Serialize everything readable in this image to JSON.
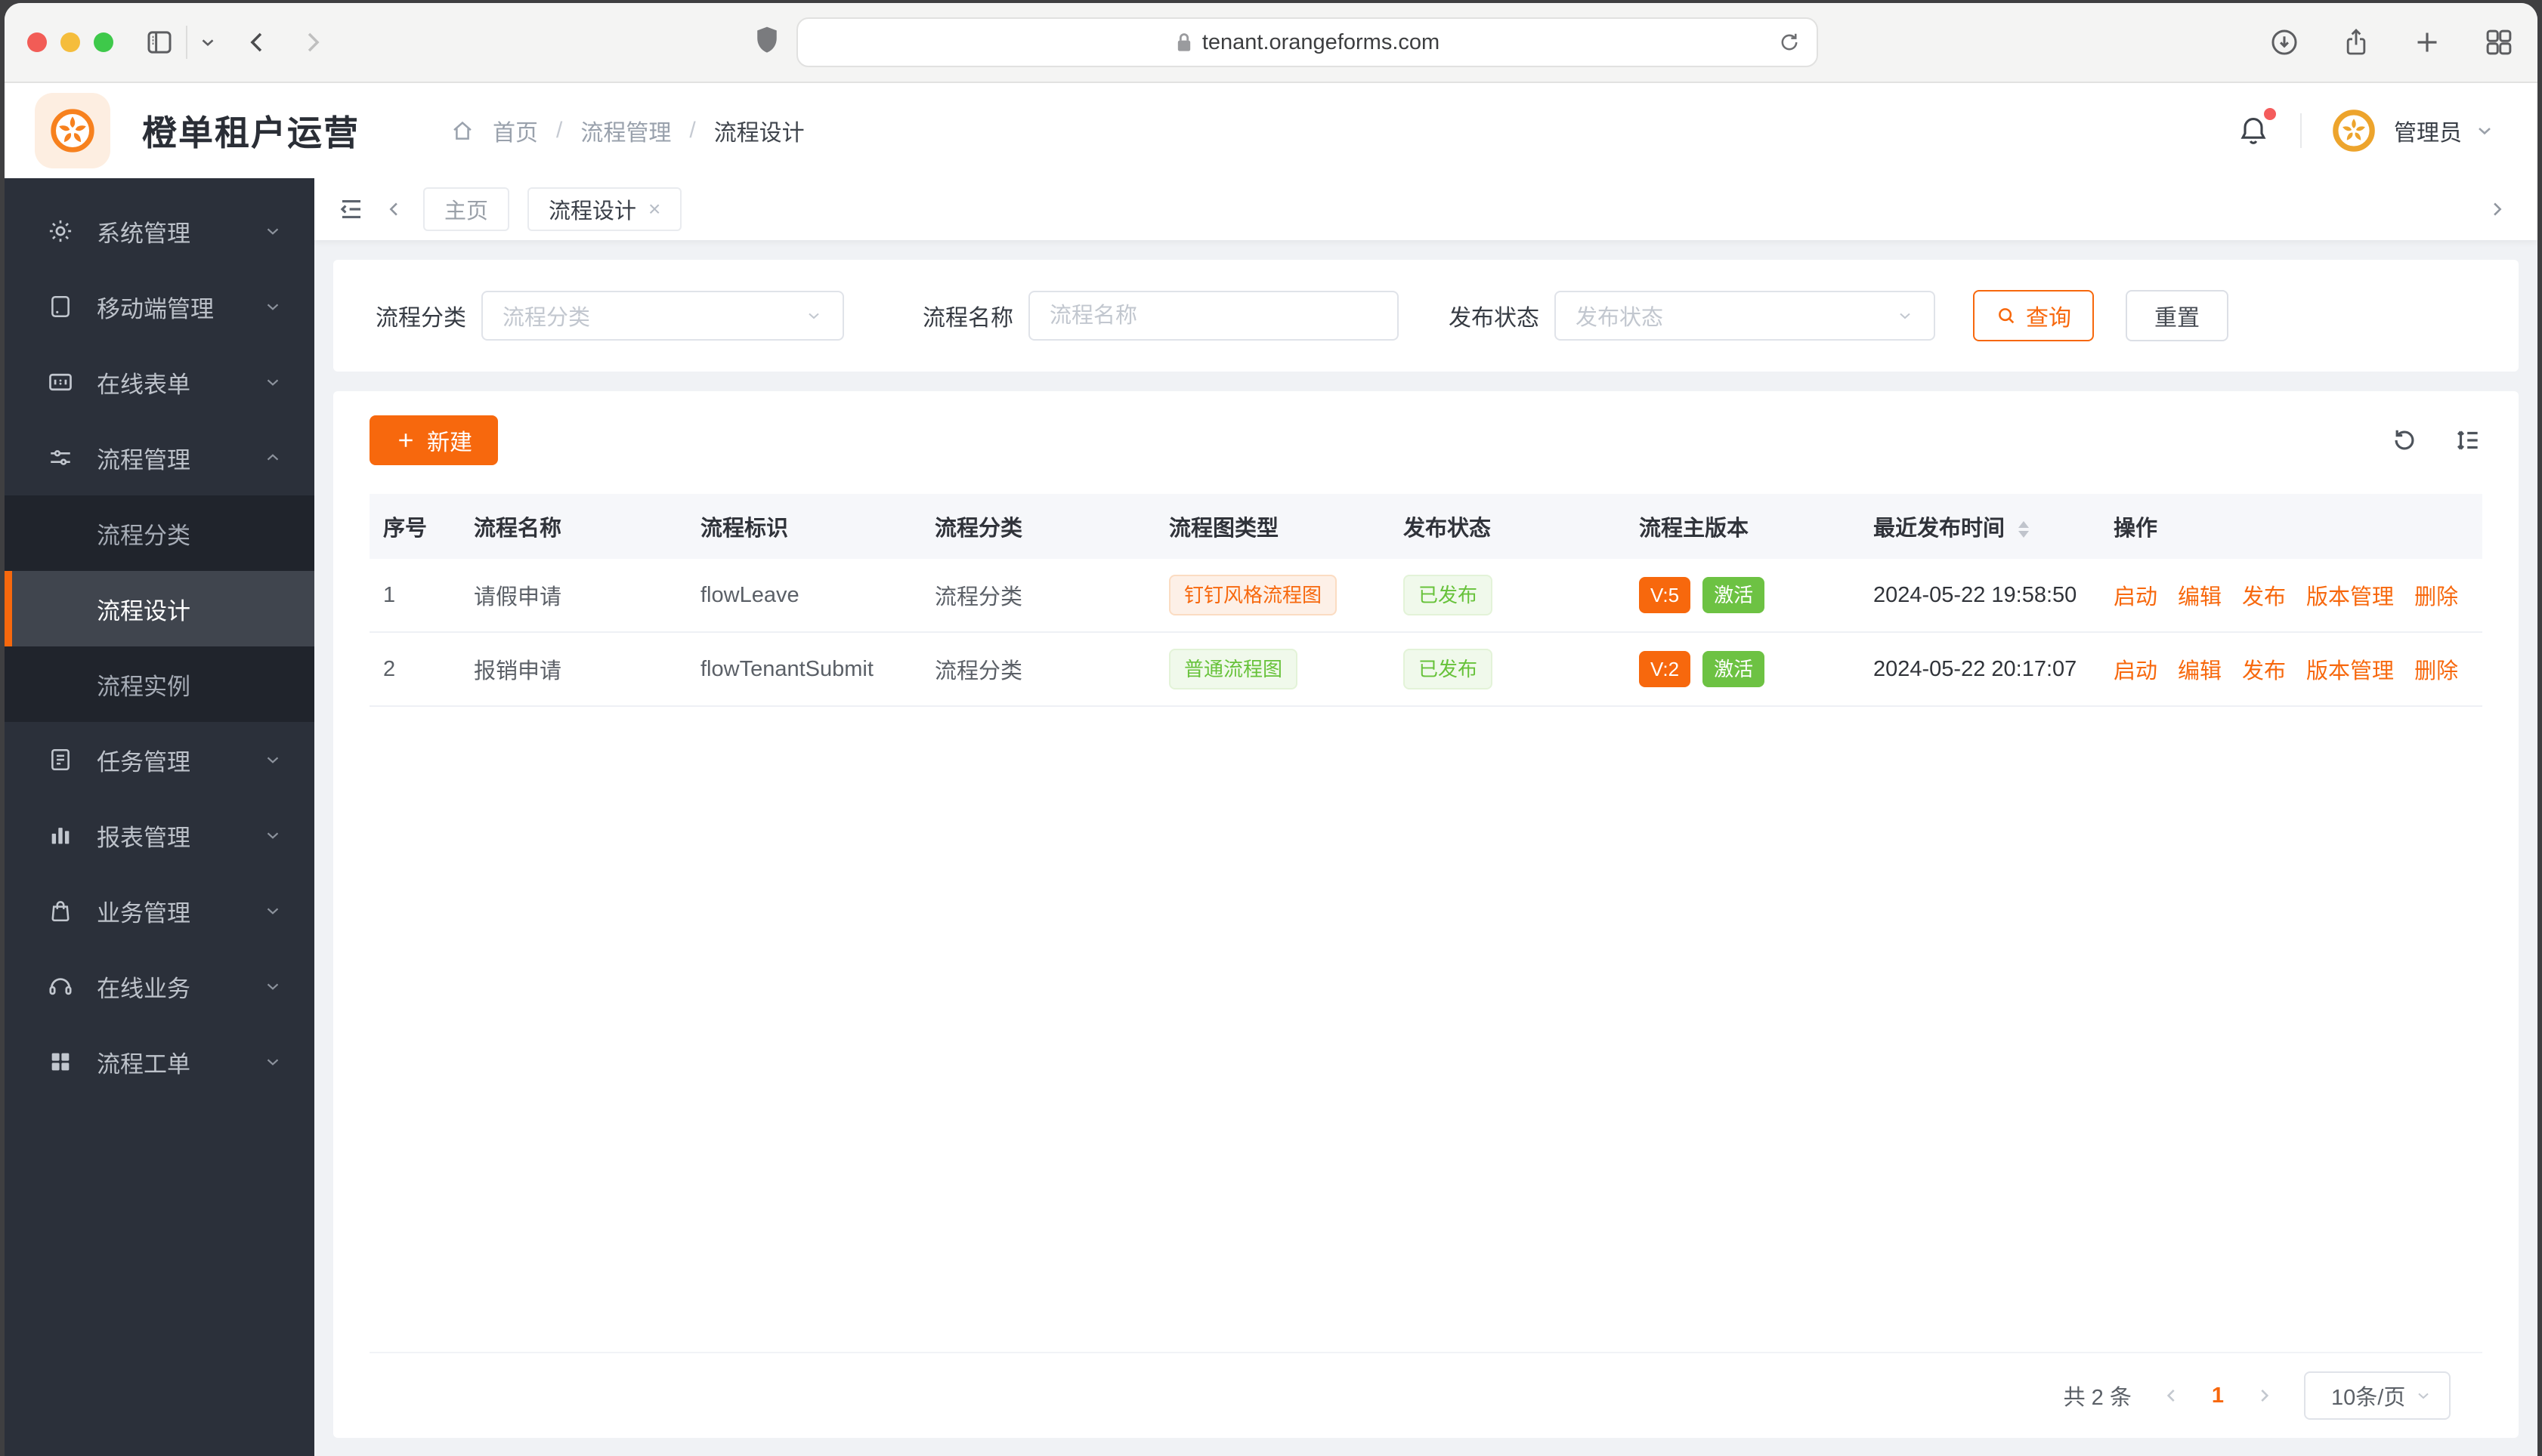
{
  "colors": {
    "accent": "#f7680d",
    "green": "#67c23a",
    "green_solid": "#6dc243",
    "sidebar_bg": "#2b303a"
  },
  "browser": {
    "url": "tenant.orangeforms.com"
  },
  "header": {
    "app_title": "橙单租户运营",
    "breadcrumb": [
      "首页",
      "流程管理",
      "流程设计"
    ],
    "user_name": "管理员"
  },
  "sidebar": {
    "items": [
      {
        "label": "系统管理"
      },
      {
        "label": "移动端管理"
      },
      {
        "label": "在线表单"
      },
      {
        "label": "流程管理",
        "expanded": true,
        "children": [
          {
            "label": "流程分类"
          },
          {
            "label": "流程设计",
            "active": true
          },
          {
            "label": "流程实例"
          }
        ]
      },
      {
        "label": "任务管理"
      },
      {
        "label": "报表管理"
      },
      {
        "label": "业务管理"
      },
      {
        "label": "在线业务"
      },
      {
        "label": "流程工单"
      }
    ]
  },
  "tabs": {
    "home": "主页",
    "current": "流程设计"
  },
  "filters": {
    "category_label": "流程分类",
    "category_placeholder": "流程分类",
    "name_label": "流程名称",
    "name_placeholder": "流程名称",
    "status_label": "发布状态",
    "status_placeholder": "发布状态",
    "query_label": "查询",
    "reset_label": "重置"
  },
  "toolbar": {
    "new_label": "新建"
  },
  "table": {
    "columns": [
      "序号",
      "流程名称",
      "流程标识",
      "流程分类",
      "流程图类型",
      "发布状态",
      "流程主版本",
      "最近发布时间",
      "操作"
    ],
    "row_actions": [
      "启动",
      "编辑",
      "发布",
      "版本管理",
      "删除"
    ],
    "rows": [
      {
        "index": "1",
        "name": "请假申请",
        "key": "flowLeave",
        "category": "流程分类",
        "diagram_type": "钉钉风格流程图",
        "diagram_style": "orange",
        "publish_status": "已发布",
        "version": "V:5",
        "version_state": "激活",
        "published_at": "2024-05-22 19:58:50"
      },
      {
        "index": "2",
        "name": "报销申请",
        "key": "flowTenantSubmit",
        "category": "流程分类",
        "diagram_type": "普通流程图",
        "diagram_style": "green",
        "publish_status": "已发布",
        "version": "V:2",
        "version_state": "激活",
        "published_at": "2024-05-22 20:17:07"
      }
    ]
  },
  "pagination": {
    "total_label": "共 2 条",
    "page": "1",
    "page_size": "10条/页"
  }
}
